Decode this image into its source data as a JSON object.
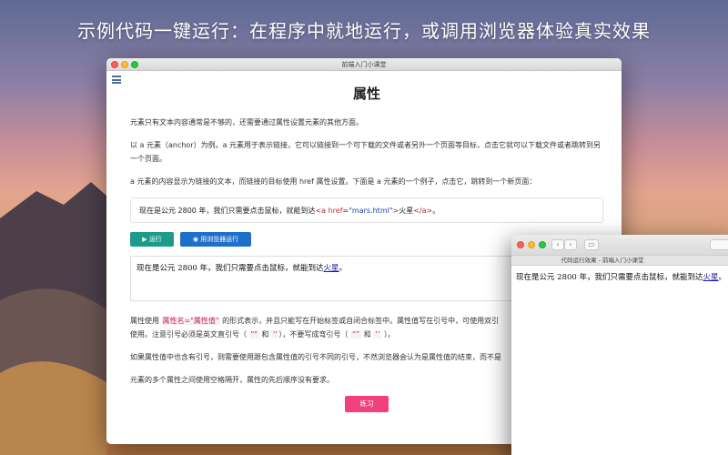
{
  "headline": "示例代码一键运行：在程序中就地运行，或调用浏览器体验真实效果",
  "main_window": {
    "title": "前端入门小课堂",
    "page_title": "属性",
    "para1": "元素只有文本内容通常是不够的，还需要通过属性设置元素的其他方面。",
    "para2": "以 a 元素（anchor）为例。a 元素用于表示链接，它可以链接到一个可下载的文件或者另外一个页面等目标，点击它就可以下载文件或者跳转到另一个页面。",
    "para3": "a 元素的内容显示为链接的文本，而链接的目标使用 href 属性设置。下面是 a 元素的一个例子，点击它，跳转到一个新页面：",
    "code": {
      "text": "现在是公元 2800 年，我们只需要点击鼠标，就能到达",
      "tag_open": "<a",
      "attr": "href",
      "eq": "=",
      "value": "\"mars.html\"",
      "tag_close_bracket": ">",
      "link_text": "火星",
      "tag_end": "</a>",
      "tail": "。"
    },
    "run_button": "运行",
    "browser_button": "用浏览器运行",
    "preview": {
      "text": "现在是公元 2800 年，我们只需要点击鼠标，就能到达",
      "link": "火星",
      "tail": "。"
    },
    "para4": {
      "a": "属性使用",
      "code": "属性名=\"属性值\"",
      "b": "的形式表示，并且只能写在开始标签或自闭合标签中。属性值写在引号中，可使用双引",
      "line2a": "使用。注意引号必须是英文直引号（",
      "chip1": "\"\"",
      "and1": "和",
      "chip2": "''",
      "line2b": "），不要写成弯引号（",
      "chip3": "“”",
      "and2": "和",
      "chip4": "‘’",
      "line2c": "）。"
    },
    "para5": "如果属性值中也含有引号，则需要使用跟包含属性值的引号不同的引号，不然浏览器会认为是属性值的结束，而不是",
    "para6": "元素的多个属性之间使用空格隔开，属性的先后顺序没有要求。",
    "practice_button": "练习"
  },
  "browser_window": {
    "title": "代码运行效果 - 前端入门小课堂",
    "back": "‹",
    "forward": "›",
    "body": {
      "text": "现在是公元 2800 年，我们只需要点击鼠标，就能到达",
      "link": "火星",
      "tail": "。"
    }
  }
}
